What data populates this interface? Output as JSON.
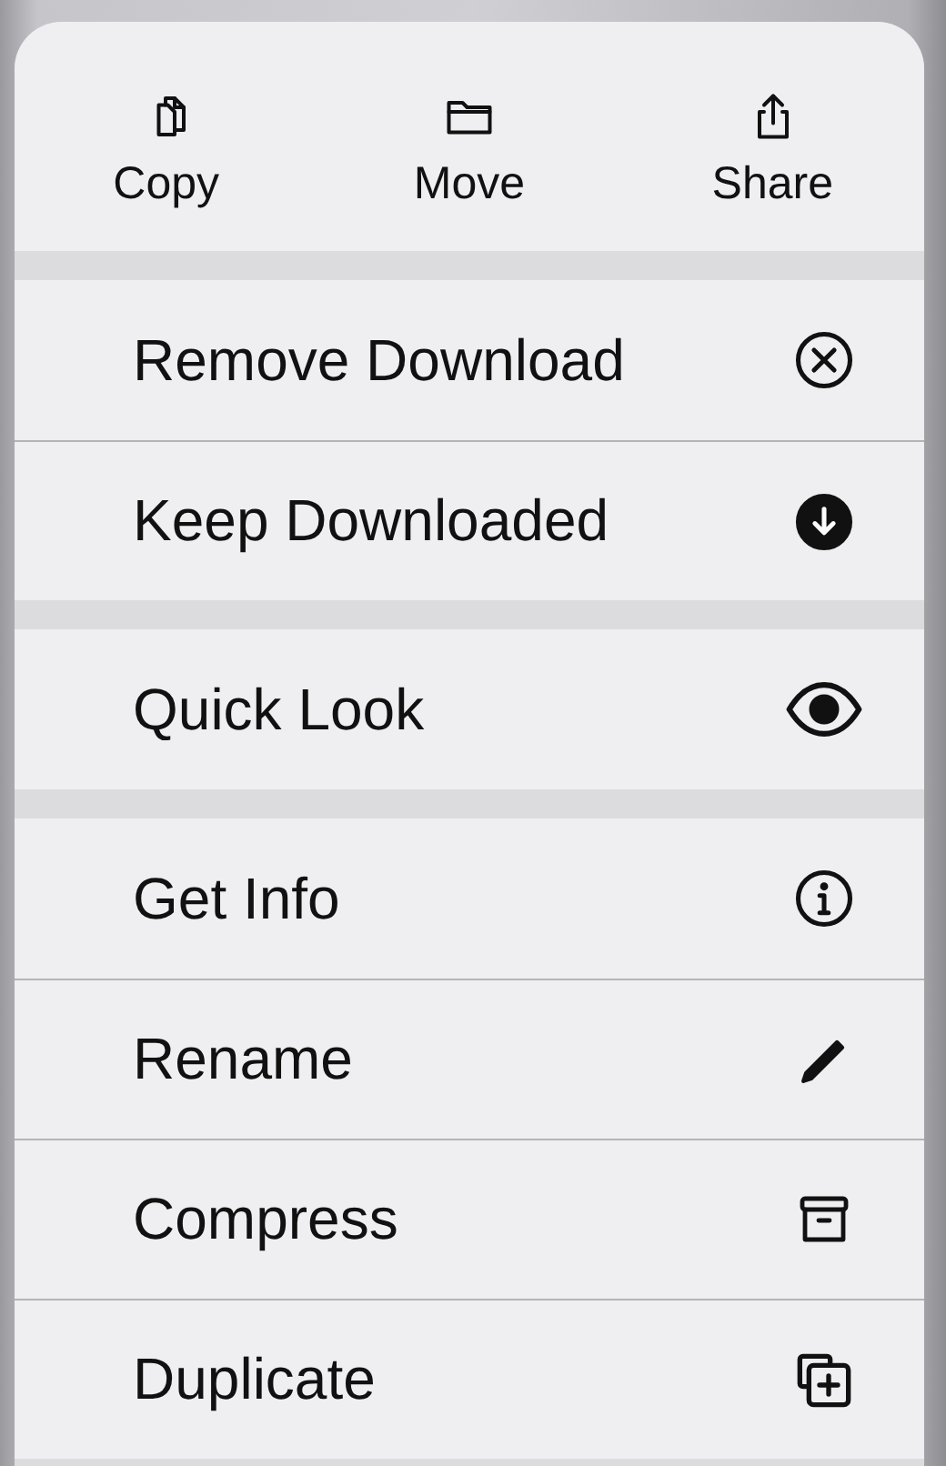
{
  "quick_actions": [
    {
      "label": "Copy"
    },
    {
      "label": "Move"
    },
    {
      "label": "Share"
    }
  ],
  "sections": [
    {
      "items": [
        {
          "label": "Remove Download"
        },
        {
          "label": "Keep Downloaded"
        }
      ]
    },
    {
      "items": [
        {
          "label": "Quick Look"
        }
      ]
    },
    {
      "items": [
        {
          "label": "Get Info"
        },
        {
          "label": "Rename"
        },
        {
          "label": "Compress"
        },
        {
          "label": "Duplicate"
        }
      ]
    }
  ]
}
